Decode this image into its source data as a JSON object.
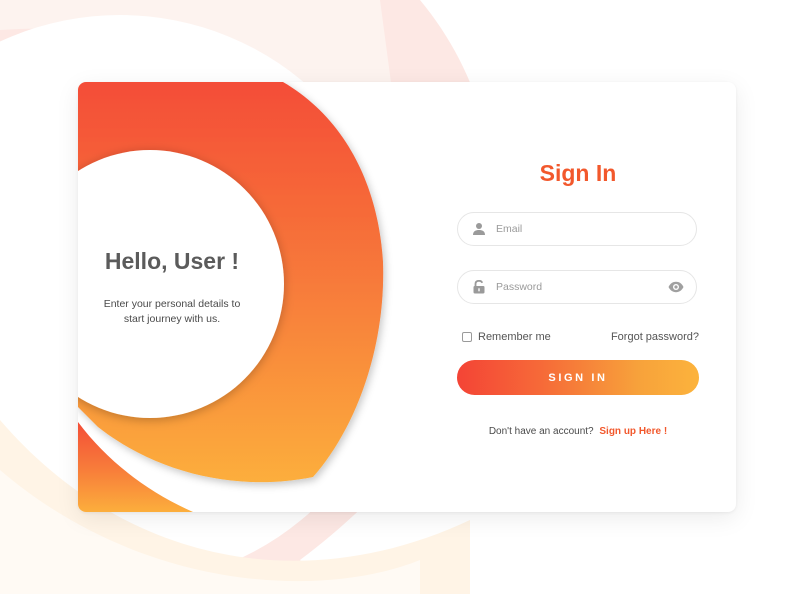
{
  "greeting": {
    "title": "Hello, User !",
    "subtitle_line1": "Enter your personal details to",
    "subtitle_line2": "start journey with us."
  },
  "form": {
    "title": "Sign In",
    "email": {
      "placeholder": "Email",
      "value": "",
      "icon": "user-icon"
    },
    "password": {
      "placeholder": "Password",
      "value": "",
      "icon": "lock-icon",
      "toggle_icon": "eye-icon"
    },
    "remember_label": "Remember me",
    "remember_checked": false,
    "forgot_label": "Forgot password?",
    "submit_label": "SIGN IN",
    "signup_prompt": "Don't have an account?",
    "signup_link": "Sign up Here !"
  },
  "colors": {
    "accent": "#f2582c",
    "gradient_start": "#f44436",
    "gradient_end": "#fcb33c",
    "text": "#5b5b5b"
  }
}
